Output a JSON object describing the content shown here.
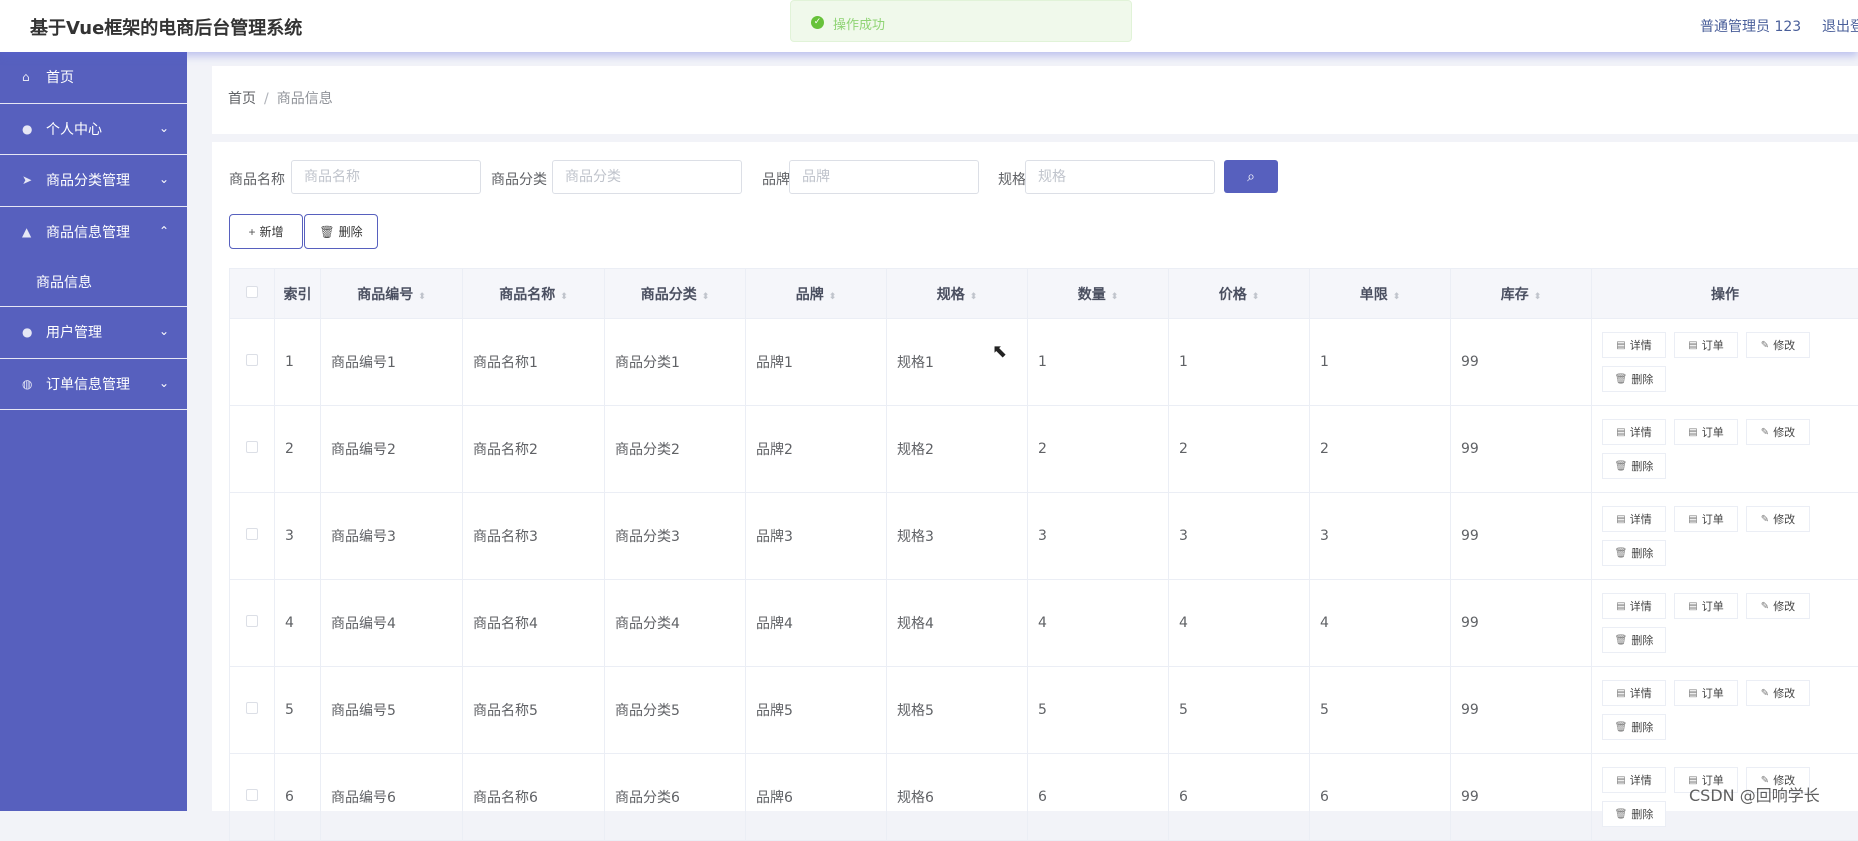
{
  "header": {
    "title": "基于Vue框架的电商后台管理系统",
    "user": "普通管理员 123",
    "logout": "退出登录"
  },
  "toast": {
    "text": "操作成功"
  },
  "sidebar": {
    "items": [
      {
        "label": "首页",
        "icon": "home-icon"
      },
      {
        "label": "个人中心",
        "icon": "user-icon"
      },
      {
        "label": "商品分类管理",
        "icon": "send-icon"
      },
      {
        "label": "商品信息管理",
        "icon": "thumb-icon",
        "open": true,
        "sub": "商品信息"
      },
      {
        "label": "用户管理",
        "icon": "user-icon"
      },
      {
        "label": "订单信息管理",
        "icon": "globe-icon"
      }
    ]
  },
  "breadcrumb": {
    "home": "首页",
    "current": "商品信息"
  },
  "search": {
    "name_label": "商品名称",
    "name_placeholder": "商品名称",
    "category_label": "商品分类",
    "category_placeholder": "商品分类",
    "brand_label": "品牌",
    "brand_placeholder": "品牌",
    "spec_label": "规格",
    "spec_placeholder": "规格"
  },
  "toolbar": {
    "add": "新增",
    "delete": "删除"
  },
  "table": {
    "headers": [
      "索引",
      "商品编号",
      "商品名称",
      "商品分类",
      "品牌",
      "规格",
      "数量",
      "价格",
      "单限",
      "库存",
      "操作"
    ],
    "ops": [
      "详情",
      "订单",
      "修改",
      "删除"
    ],
    "rows": [
      [
        "1",
        "商品编号1",
        "商品名称1",
        "商品分类1",
        "品牌1",
        "规格1",
        "1",
        "1",
        "1",
        "99"
      ],
      [
        "2",
        "商品编号2",
        "商品名称2",
        "商品分类2",
        "品牌2",
        "规格2",
        "2",
        "2",
        "2",
        "99"
      ],
      [
        "3",
        "商品编号3",
        "商品名称3",
        "商品分类3",
        "品牌3",
        "规格3",
        "3",
        "3",
        "3",
        "99"
      ],
      [
        "4",
        "商品编号4",
        "商品名称4",
        "商品分类4",
        "品牌4",
        "规格4",
        "4",
        "4",
        "4",
        "99"
      ],
      [
        "5",
        "商品编号5",
        "商品名称5",
        "商品分类5",
        "品牌5",
        "规格5",
        "5",
        "5",
        "5",
        "99"
      ],
      [
        "6",
        "商品编号6",
        "商品名称6",
        "商品分类6",
        "品牌6",
        "规格6",
        "6",
        "6",
        "6",
        "99"
      ]
    ]
  },
  "watermark": "CSDN @回响学长",
  "colors": {
    "primary": "#5760be",
    "success": "#67c23a"
  }
}
